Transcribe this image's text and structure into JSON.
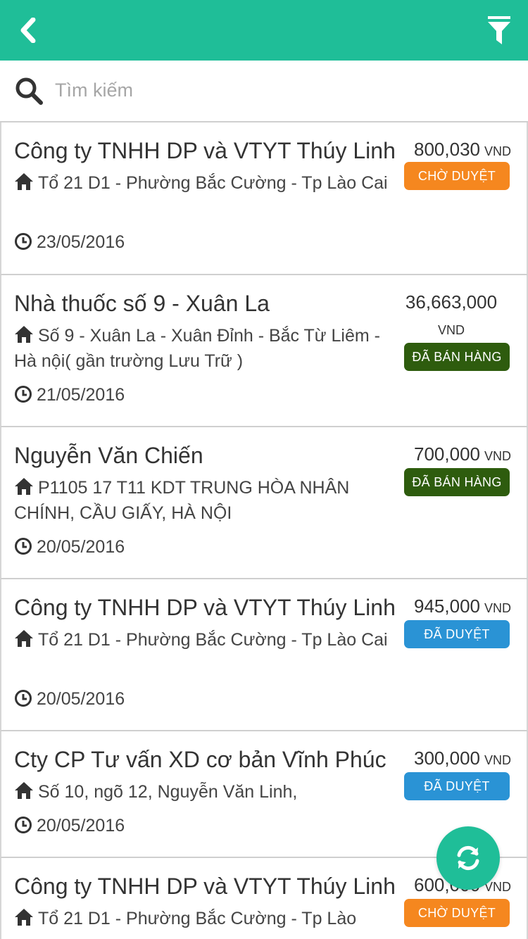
{
  "header": {
    "back_icon": "chevron-left-icon",
    "filter_icon": "filter-icon",
    "color": "#1fbe98"
  },
  "search": {
    "icon": "search-icon",
    "placeholder": "Tìm kiếm",
    "value": ""
  },
  "status_colors": {
    "pending": "#f5871f",
    "sold": "#2e5c0e",
    "approved": "#2a93d5"
  },
  "orders": [
    {
      "name": "Công ty TNHH DP và VTYT Thúy Linh",
      "address": "Tổ 21 D1 - Phường Bắc Cường - Tp Lào Cai",
      "date": "23/05/2016",
      "amount": "800,030",
      "currency": "VND",
      "status": "CHỜ DUYỆT",
      "status_type": "pending"
    },
    {
      "name": "Nhà thuốc số 9 - Xuân La",
      "address": "Số 9 - Xuân La - Xuân Đỉnh - Bắc Từ Liêm - Hà nội( gần trường Lưu Trữ )",
      "date": "21/05/2016",
      "amount": "36,663,000",
      "currency": "VND",
      "status": "ĐÃ BÁN HÀNG",
      "status_type": "sold"
    },
    {
      "name": "Nguyễn Văn Chiến",
      "address": "P1105 17 T11 KDT TRUNG HÒA NHÂN CHÍNH, CẦU GIẤY, HÀ NỘI",
      "date": "20/05/2016",
      "amount": "700,000",
      "currency": "VND",
      "status": "ĐÃ BÁN HÀNG",
      "status_type": "sold"
    },
    {
      "name": "Công ty TNHH DP và VTYT Thúy Linh",
      "address": "Tổ 21 D1 - Phường Bắc Cường - Tp Lào Cai",
      "date": "20/05/2016",
      "amount": "945,000",
      "currency": "VND",
      "status": "ĐÃ DUYỆT",
      "status_type": "approved"
    },
    {
      "name": "Cty CP Tư vấn XD cơ bản Vĩnh Phúc",
      "address": "Số 10, ngõ 12, Nguyễn Văn Linh,",
      "date": "20/05/2016",
      "amount": "300,000",
      "currency": "VND",
      "status": "ĐÃ DUYỆT",
      "status_type": "approved"
    },
    {
      "name": "Công ty TNHH DP và VTYT Thúy Linh",
      "address": "Tổ 21 D1 - Phường Bắc Cường - Tp Lào",
      "date": "",
      "amount": "600,000",
      "currency": "VND",
      "status": "CHỜ DUYỆT",
      "status_type": "pending"
    }
  ],
  "fab": {
    "icon": "refresh-icon"
  }
}
